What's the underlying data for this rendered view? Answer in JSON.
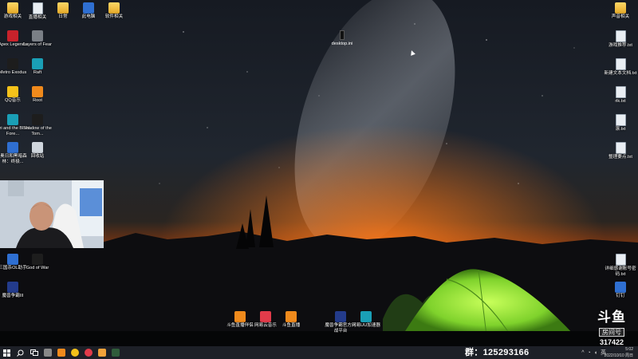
{
  "desktop": {
    "left_col1": [
      {
        "label": "游戏相关",
        "icon": "folder-icon"
      },
      {
        "label": "Apex Legends",
        "icon": "apex-legends-icon"
      },
      {
        "label": "Metro Exodus",
        "icon": "metro-exodus-icon"
      },
      {
        "label": "QQ音乐",
        "icon": "qq-music-icon"
      },
      {
        "label": "Ori and the Blind Fore...",
        "icon": "ori-icon"
      },
      {
        "label": "(奥日和黑暗森林：终极...",
        "icon": "ori-de-icon"
      },
      {
        "label": "三国杀OL助手",
        "icon": "sanguosha-icon"
      },
      {
        "label": "魔兽争霸III",
        "icon": "warcraft-icon"
      }
    ],
    "left_col2": [
      {
        "label": "直播相关",
        "icon": "document-icon"
      },
      {
        "label": "Layers of Fear",
        "icon": "layers-of-fear-icon"
      },
      {
        "label": "Raft",
        "icon": "raft-icon"
      },
      {
        "label": "Root",
        "icon": "root-icon"
      },
      {
        "label": "Shadow of the Tom...",
        "icon": "shadow-tomb-raider-icon"
      },
      {
        "label": "回收站",
        "icon": "recycle-bin-icon"
      },
      {
        "label": "God of War",
        "icon": "god-of-war-icon"
      }
    ],
    "top_row": [
      {
        "label": "日常",
        "icon": "folder-icon"
      },
      {
        "label": "此电脑",
        "icon": "this-pc-icon"
      },
      {
        "label": "软件相关",
        "icon": "folder-icon"
      }
    ],
    "right_col": [
      {
        "label": "声音相关",
        "icon": "folder-icon"
      },
      {
        "label": "游戏推荐.txt",
        "icon": "text-file-icon"
      },
      {
        "label": "新建文本文档.txt",
        "icon": "text-file-icon"
      },
      {
        "label": "rlk.txt",
        "icon": "text-file-icon"
      },
      {
        "label": "滚.txt",
        "icon": "text-file-icon"
      },
      {
        "label": "整理要点.txt",
        "icon": "text-file-icon"
      },
      {
        "label": "详细感谢账号密码.txt",
        "icon": "text-file-icon"
      },
      {
        "label": "钉钉",
        "icon": "dingtalk-icon"
      }
    ],
    "bottom_row": [
      {
        "label": "斗鱼直播伴侣",
        "icon": "douyu-companion-icon"
      },
      {
        "label": "网易云音乐",
        "icon": "netease-music-icon"
      },
      {
        "label": "斗鱼直播",
        "icon": "douyu-live-icon"
      },
      {
        "label": "魔兽争霸官方对战平台",
        "icon": "warcraft-platform-icon"
      },
      {
        "label": "网易UU加速器",
        "icon": "uu-accelerator-icon"
      }
    ],
    "selected_file_label": "desktop.ini"
  },
  "overlay": {
    "brand": "斗鱼",
    "room_label": "房间号",
    "room_id": "317422",
    "group_text": "群：125293166"
  },
  "taskbar": {
    "start_icon": "windows-start-icon",
    "apps": [
      "search-icon",
      "task-view-icon",
      "file-explorer-icon",
      "douyu-icon",
      "chrome-icon",
      "netease-music-icon",
      "game-icon",
      "warcraft-icon"
    ],
    "time": "5:02",
    "date": "2022/10/10 周日"
  },
  "colors": {
    "taskbar": "#1d2027",
    "tent": "#8be03a",
    "horizon_glow": "#ff7a1a"
  }
}
